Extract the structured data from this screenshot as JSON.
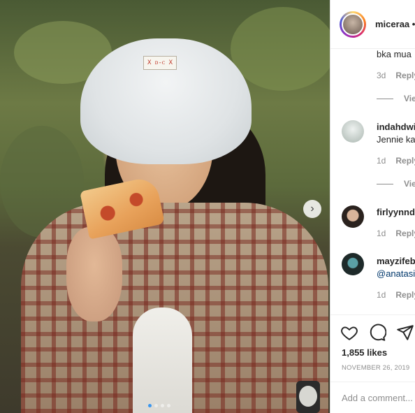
{
  "post": {
    "username": "miceraa",
    "separator": "•",
    "image_alt": "Photo by miceraa",
    "hat_label": "X ᴅ-ᴄ X",
    "carousel": {
      "total": 4,
      "active": 0
    }
  },
  "comments": [
    {
      "user": "",
      "text": "bka mua",
      "age": "3d",
      "reply_label": "Reply",
      "view_label": "Vie"
    },
    {
      "user": "indahdwi",
      "text": "Jennie ka",
      "age": "1d",
      "reply_label": "Reply",
      "view_label": "Vie"
    },
    {
      "user": "firlyynnd",
      "text": "",
      "age": "1d",
      "reply_label": "Reply"
    },
    {
      "user": "mayzifeb",
      "text": "@anatasi",
      "age": "1d",
      "reply_label": "Reply"
    }
  ],
  "actions": {
    "likes": "1,855 likes",
    "date": "NOVEMBER 26, 2019"
  },
  "add_comment": {
    "placeholder": "Add a comment..."
  },
  "icons": {
    "like": "heart-icon",
    "comment": "comment-bubble-icon",
    "share": "paper-plane-icon",
    "next": "chevron-right-icon"
  },
  "colors": {
    "accent": "#3a97f0",
    "text": "#262626",
    "muted": "#8e8e8e",
    "link": "#00376b"
  }
}
